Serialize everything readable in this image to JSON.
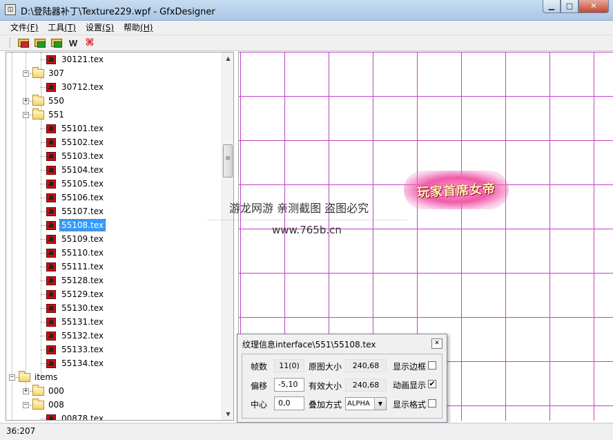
{
  "window": {
    "title": "D:\\登陆器补丁\\Texture229.wpf - GfxDesigner",
    "minimize_glyph": "▁",
    "maximize_glyph": "□",
    "close_glyph": "✕"
  },
  "menu": [
    {
      "label": "文件",
      "accel": "(F)"
    },
    {
      "label": "工具",
      "accel": "(T)"
    },
    {
      "label": "设置",
      "accel": "(S)"
    },
    {
      "label": "帮助",
      "accel": "(H)"
    }
  ],
  "toolbar": {
    "w_label": "W"
  },
  "tree": {
    "items": [
      {
        "label": "30121.tex",
        "type": "tex",
        "indent": 2
      },
      {
        "label": "307",
        "type": "folder",
        "indent": 1,
        "expander": "−"
      },
      {
        "label": "30712.tex",
        "type": "tex",
        "indent": 2
      },
      {
        "label": "550",
        "type": "folder",
        "indent": 1,
        "expander": "+"
      },
      {
        "label": "551",
        "type": "folder",
        "indent": 1,
        "expander": "−"
      },
      {
        "label": "55101.tex",
        "type": "tex",
        "indent": 2
      },
      {
        "label": "55102.tex",
        "type": "tex",
        "indent": 2
      },
      {
        "label": "55103.tex",
        "type": "tex",
        "indent": 2
      },
      {
        "label": "55104.tex",
        "type": "tex",
        "indent": 2
      },
      {
        "label": "55105.tex",
        "type": "tex",
        "indent": 2
      },
      {
        "label": "55106.tex",
        "type": "tex",
        "indent": 2
      },
      {
        "label": "55107.tex",
        "type": "tex",
        "indent": 2
      },
      {
        "label": "55108.tex",
        "type": "tex",
        "indent": 2,
        "selected": true
      },
      {
        "label": "55109.tex",
        "type": "tex",
        "indent": 2
      },
      {
        "label": "55110.tex",
        "type": "tex",
        "indent": 2
      },
      {
        "label": "55111.tex",
        "type": "tex",
        "indent": 2
      },
      {
        "label": "55128.tex",
        "type": "tex",
        "indent": 2
      },
      {
        "label": "55129.tex",
        "type": "tex",
        "indent": 2
      },
      {
        "label": "55130.tex",
        "type": "tex",
        "indent": 2
      },
      {
        "label": "55131.tex",
        "type": "tex",
        "indent": 2
      },
      {
        "label": "55132.tex",
        "type": "tex",
        "indent": 2
      },
      {
        "label": "55133.tex",
        "type": "tex",
        "indent": 2
      },
      {
        "label": "55134.tex",
        "type": "tex",
        "indent": 2
      },
      {
        "label": "items",
        "type": "folder",
        "indent": 0,
        "expander": "−"
      },
      {
        "label": "000",
        "type": "folder",
        "indent": 1,
        "expander": "+"
      },
      {
        "label": "008",
        "type": "folder",
        "indent": 1,
        "expander": "−"
      },
      {
        "label": "00878.tex",
        "type": "tex",
        "indent": 2
      }
    ]
  },
  "canvas": {
    "grid_color": "#c040c8",
    "sprite_text": "玩家首席女帝"
  },
  "watermark": {
    "line1": "游龙网游 亲测截图 盗图必究",
    "line2": "www.765b.cn"
  },
  "dialog": {
    "title": "纹理信息interface\\551\\55108.tex",
    "close_glyph": "✕",
    "frames_label": "帧数",
    "frames_value": "11(0)",
    "orig_size_label": "原图大小",
    "orig_size_value": "240,68",
    "show_border_label": "显示边框",
    "show_border_checked": false,
    "offset_label": "偏移",
    "offset_value": "-5,10",
    "valid_size_label": "有效大小",
    "valid_size_value": "240,68",
    "anim_label": "动画显示",
    "anim_checked": true,
    "center_label": "中心",
    "center_value": "0,0",
    "blend_label": "叠加方式",
    "blend_value": "ALPHA",
    "show_grid_label": "显示格式",
    "show_grid_checked": false,
    "check_mark": "✔"
  },
  "status": {
    "coords": "36:207"
  }
}
